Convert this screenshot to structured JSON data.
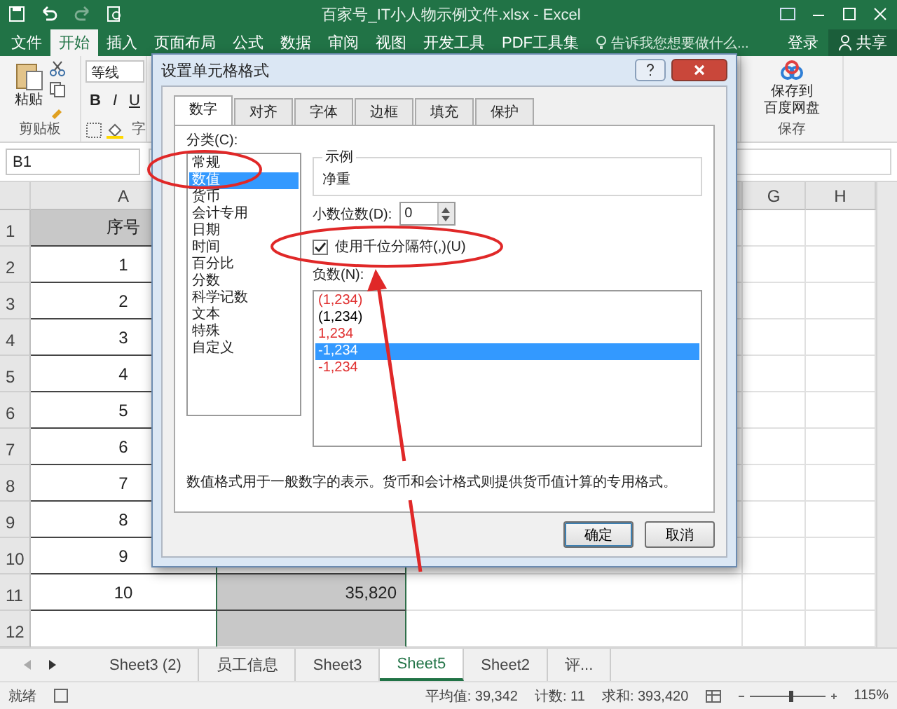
{
  "window": {
    "title": "百家号_IT小人物示例文件.xlsx - Excel"
  },
  "ribbon_tabs": [
    {
      "label": "文件",
      "selected": false
    },
    {
      "label": "开始",
      "selected": true
    },
    {
      "label": "插入",
      "selected": false
    },
    {
      "label": "页面布局",
      "selected": false
    },
    {
      "label": "公式",
      "selected": false
    },
    {
      "label": "数据",
      "selected": false
    },
    {
      "label": "审阅",
      "selected": false
    },
    {
      "label": "视图",
      "selected": false
    },
    {
      "label": "开发工具",
      "selected": false
    },
    {
      "label": "PDF工具集",
      "selected": false
    }
  ],
  "tell_me": {
    "placeholder": "告诉我您想要做什么..."
  },
  "account": {
    "sign_in": "登录",
    "share": "共享"
  },
  "ribbon": {
    "paste": "粘贴",
    "clipboard_group": "剪贴板",
    "font_name": "等线",
    "bold": "B",
    "italic": "I",
    "underline": "U",
    "font_group": "字",
    "cloud_save": [
      "保存到",
      "百度网盘"
    ],
    "save_group": "保存"
  },
  "name_box": {
    "value": "B1"
  },
  "grid": {
    "column_headers": [
      "A",
      "G",
      "H"
    ],
    "rows": [
      {
        "number": "1",
        "column_a": "序号"
      },
      {
        "number": "2",
        "column_a": "1"
      },
      {
        "number": "3",
        "column_a": "2"
      },
      {
        "number": "4",
        "column_a": "3"
      },
      {
        "number": "5",
        "column_a": "4"
      },
      {
        "number": "6",
        "column_a": "5"
      },
      {
        "number": "7",
        "column_a": "6"
      },
      {
        "number": "8",
        "column_a": "7"
      },
      {
        "number": "9",
        "column_a": "8"
      },
      {
        "number": "10",
        "column_a": "9"
      },
      {
        "number": "11",
        "column_a": "10",
        "column_b": "35,820"
      },
      {
        "number": "12"
      }
    ]
  },
  "sheet_tabs": [
    {
      "label": "Sheet3 (2)",
      "selected": false
    },
    {
      "label": "员工信息",
      "selected": false
    },
    {
      "label": "Sheet3",
      "selected": false
    },
    {
      "label": "Sheet5",
      "selected": true
    },
    {
      "label": "Sheet2",
      "selected": false
    },
    {
      "label": "评...",
      "selected": false
    }
  ],
  "status_bar": {
    "ready": "就绪",
    "average": "平均值: 39,342",
    "count": "计数: 11",
    "sum": "求和: 393,420",
    "zoom": "115%"
  },
  "dialog": {
    "title": "设置单元格格式",
    "tabs": [
      {
        "label": "数字",
        "selected": true
      },
      {
        "label": "对齐",
        "selected": false
      },
      {
        "label": "字体",
        "selected": false
      },
      {
        "label": "边框",
        "selected": false
      },
      {
        "label": "填充",
        "selected": false
      },
      {
        "label": "保护",
        "selected": false
      }
    ],
    "category_label": "分类(C):",
    "categories": [
      {
        "label": "常规",
        "selected": false
      },
      {
        "label": "数值",
        "selected": true
      },
      {
        "label": "货币",
        "selected": false
      },
      {
        "label": "会计专用",
        "selected": false
      },
      {
        "label": "日期",
        "selected": false
      },
      {
        "label": "时间",
        "selected": false
      },
      {
        "label": "百分比",
        "selected": false
      },
      {
        "label": "分数",
        "selected": false
      },
      {
        "label": "科学记数",
        "selected": false
      },
      {
        "label": "文本",
        "selected": false
      },
      {
        "label": "特殊",
        "selected": false
      },
      {
        "label": "自定义",
        "selected": false
      }
    ],
    "sample_label": "示例",
    "sample_value": "净重",
    "decimals_label": "小数位数(D):",
    "decimals_value": "0",
    "thousands": {
      "label": "使用千位分隔符(,)(U)",
      "checked": true
    },
    "negative_label": "负数(N):",
    "negatives": [
      {
        "label": "(1,234)",
        "color": "#e03030",
        "selected": false
      },
      {
        "label": "(1,234)",
        "color": "#000000",
        "selected": false
      },
      {
        "label": "1,234",
        "color": "#e03030",
        "selected": false
      },
      {
        "label": "-1,234",
        "selected": true
      },
      {
        "label": "-1,234",
        "color": "#e03030",
        "selected": false
      }
    ],
    "description": "数值格式用于一般数字的表示。货币和会计格式则提供货币值计算的专用格式。",
    "buttons": [
      "确定",
      "取消"
    ]
  }
}
